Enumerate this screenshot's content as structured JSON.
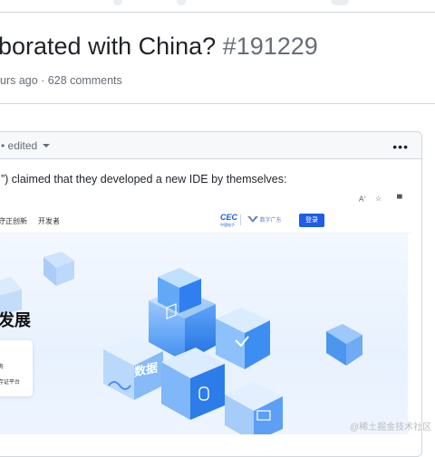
{
  "issue": {
    "title": "borated with China?",
    "number": "#191229",
    "meta": "urs ago · 628 comments"
  },
  "comment": {
    "edited_label": "• edited",
    "menu_icon": "•••",
    "body": "”) claimed that they developed a new IDE by themselves:"
  },
  "screenshot": {
    "nav_links": [
      "守正创新",
      "开发者"
    ],
    "brand_name": "CEC",
    "brand_sub": "中国电子",
    "partner_logo": "数字广东",
    "login_label": "登录",
    "hero_title": "发展",
    "card_line1": "务",
    "card_line2": "存证平台",
    "cube_label": "数据"
  },
  "watermark": "@稀土掘金技术社区",
  "colors": {
    "accent": "#1c5fe6",
    "muted": "#656d76",
    "border": "#d0d7de"
  }
}
